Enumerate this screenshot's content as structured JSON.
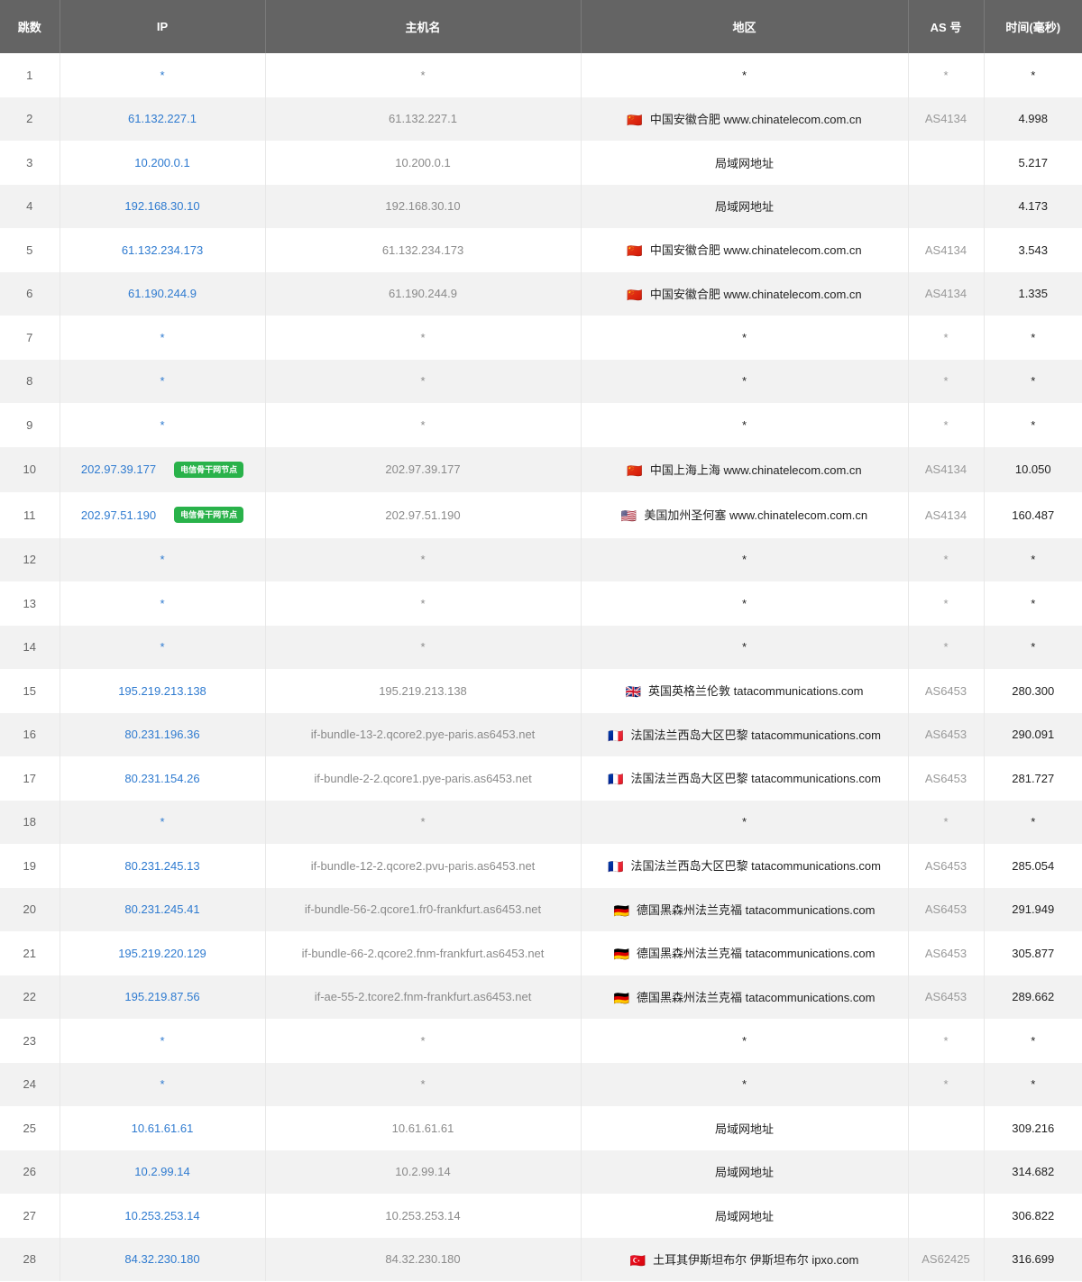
{
  "columns": [
    "跳数",
    "IP",
    "主机名",
    "地区",
    "AS 号",
    "时间(毫秒)"
  ],
  "badge_label": "电信骨干网节点",
  "rows": [
    {
      "hop": "1",
      "ip": "*",
      "host": "*",
      "flag": "",
      "region": "*",
      "as": "*",
      "time": "*"
    },
    {
      "hop": "2",
      "ip": "61.132.227.1",
      "host": "61.132.227.1",
      "flag": "🇨🇳",
      "region": "中国安徽合肥 www.chinatelecom.com.cn",
      "as": "AS4134",
      "time": "4.998"
    },
    {
      "hop": "3",
      "ip": "10.200.0.1",
      "host": "10.200.0.1",
      "flag": "",
      "region": "局域网地址",
      "as": "",
      "time": "5.217"
    },
    {
      "hop": "4",
      "ip": "192.168.30.10",
      "host": "192.168.30.10",
      "flag": "",
      "region": "局域网地址",
      "as": "",
      "time": "4.173"
    },
    {
      "hop": "5",
      "ip": "61.132.234.173",
      "host": "61.132.234.173",
      "flag": "🇨🇳",
      "region": "中国安徽合肥 www.chinatelecom.com.cn",
      "as": "AS4134",
      "time": "3.543"
    },
    {
      "hop": "6",
      "ip": "61.190.244.9",
      "host": "61.190.244.9",
      "flag": "🇨🇳",
      "region": "中国安徽合肥 www.chinatelecom.com.cn",
      "as": "AS4134",
      "time": "1.335"
    },
    {
      "hop": "7",
      "ip": "*",
      "host": "*",
      "flag": "",
      "region": "*",
      "as": "*",
      "time": "*"
    },
    {
      "hop": "8",
      "ip": "*",
      "host": "*",
      "flag": "",
      "region": "*",
      "as": "*",
      "time": "*"
    },
    {
      "hop": "9",
      "ip": "*",
      "host": "*",
      "flag": "",
      "region": "*",
      "as": "*",
      "time": "*"
    },
    {
      "hop": "10",
      "ip": "202.97.39.177",
      "badge": true,
      "host": "202.97.39.177",
      "flag": "🇨🇳",
      "region": "中国上海上海 www.chinatelecom.com.cn",
      "as": "AS4134",
      "time": "10.050"
    },
    {
      "hop": "11",
      "ip": "202.97.51.190",
      "badge": true,
      "host": "202.97.51.190",
      "flag": "🇺🇸",
      "region": "美国加州圣何塞 www.chinatelecom.com.cn",
      "as": "AS4134",
      "time": "160.487"
    },
    {
      "hop": "12",
      "ip": "*",
      "host": "*",
      "flag": "",
      "region": "*",
      "as": "*",
      "time": "*"
    },
    {
      "hop": "13",
      "ip": "*",
      "host": "*",
      "flag": "",
      "region": "*",
      "as": "*",
      "time": "*"
    },
    {
      "hop": "14",
      "ip": "*",
      "host": "*",
      "flag": "",
      "region": "*",
      "as": "*",
      "time": "*"
    },
    {
      "hop": "15",
      "ip": "195.219.213.138",
      "host": "195.219.213.138",
      "flag": "🇬🇧",
      "region": "英国英格兰伦敦 tatacommunications.com",
      "as": "AS6453",
      "time": "280.300"
    },
    {
      "hop": "16",
      "ip": "80.231.196.36",
      "host": "if-bundle-13-2.qcore2.pye-paris.as6453.net",
      "flag": "🇫🇷",
      "region": "法国法兰西岛大区巴黎 tatacommunications.com",
      "as": "AS6453",
      "time": "290.091"
    },
    {
      "hop": "17",
      "ip": "80.231.154.26",
      "host": "if-bundle-2-2.qcore1.pye-paris.as6453.net",
      "flag": "🇫🇷",
      "region": "法国法兰西岛大区巴黎 tatacommunications.com",
      "as": "AS6453",
      "time": "281.727"
    },
    {
      "hop": "18",
      "ip": "*",
      "host": "*",
      "flag": "",
      "region": "*",
      "as": "*",
      "time": "*"
    },
    {
      "hop": "19",
      "ip": "80.231.245.13",
      "host": "if-bundle-12-2.qcore2.pvu-paris.as6453.net",
      "flag": "🇫🇷",
      "region": "法国法兰西岛大区巴黎 tatacommunications.com",
      "as": "AS6453",
      "time": "285.054"
    },
    {
      "hop": "20",
      "ip": "80.231.245.41",
      "host": "if-bundle-56-2.qcore1.fr0-frankfurt.as6453.net",
      "flag": "🇩🇪",
      "region": "德国黑森州法兰克福 tatacommunications.com",
      "as": "AS6453",
      "time": "291.949"
    },
    {
      "hop": "21",
      "ip": "195.219.220.129",
      "host": "if-bundle-66-2.qcore2.fnm-frankfurt.as6453.net",
      "flag": "🇩🇪",
      "region": "德国黑森州法兰克福 tatacommunications.com",
      "as": "AS6453",
      "time": "305.877"
    },
    {
      "hop": "22",
      "ip": "195.219.87.56",
      "host": "if-ae-55-2.tcore2.fnm-frankfurt.as6453.net",
      "flag": "🇩🇪",
      "region": "德国黑森州法兰克福 tatacommunications.com",
      "as": "AS6453",
      "time": "289.662"
    },
    {
      "hop": "23",
      "ip": "*",
      "host": "*",
      "flag": "",
      "region": "*",
      "as": "*",
      "time": "*"
    },
    {
      "hop": "24",
      "ip": "*",
      "host": "*",
      "flag": "",
      "region": "*",
      "as": "*",
      "time": "*"
    },
    {
      "hop": "25",
      "ip": "10.61.61.61",
      "host": "10.61.61.61",
      "flag": "",
      "region": "局域网地址",
      "as": "",
      "time": "309.216"
    },
    {
      "hop": "26",
      "ip": "10.2.99.14",
      "host": "10.2.99.14",
      "flag": "",
      "region": "局域网地址",
      "as": "",
      "time": "314.682"
    },
    {
      "hop": "27",
      "ip": "10.253.253.14",
      "host": "10.253.253.14",
      "flag": "",
      "region": "局域网地址",
      "as": "",
      "time": "306.822"
    },
    {
      "hop": "28",
      "ip": "84.32.230.180",
      "host": "84.32.230.180",
      "flag": "🇹🇷",
      "region": "土耳其伊斯坦布尔 伊斯坦布尔 ipxo.com",
      "as": "AS62425",
      "time": "316.699"
    }
  ]
}
